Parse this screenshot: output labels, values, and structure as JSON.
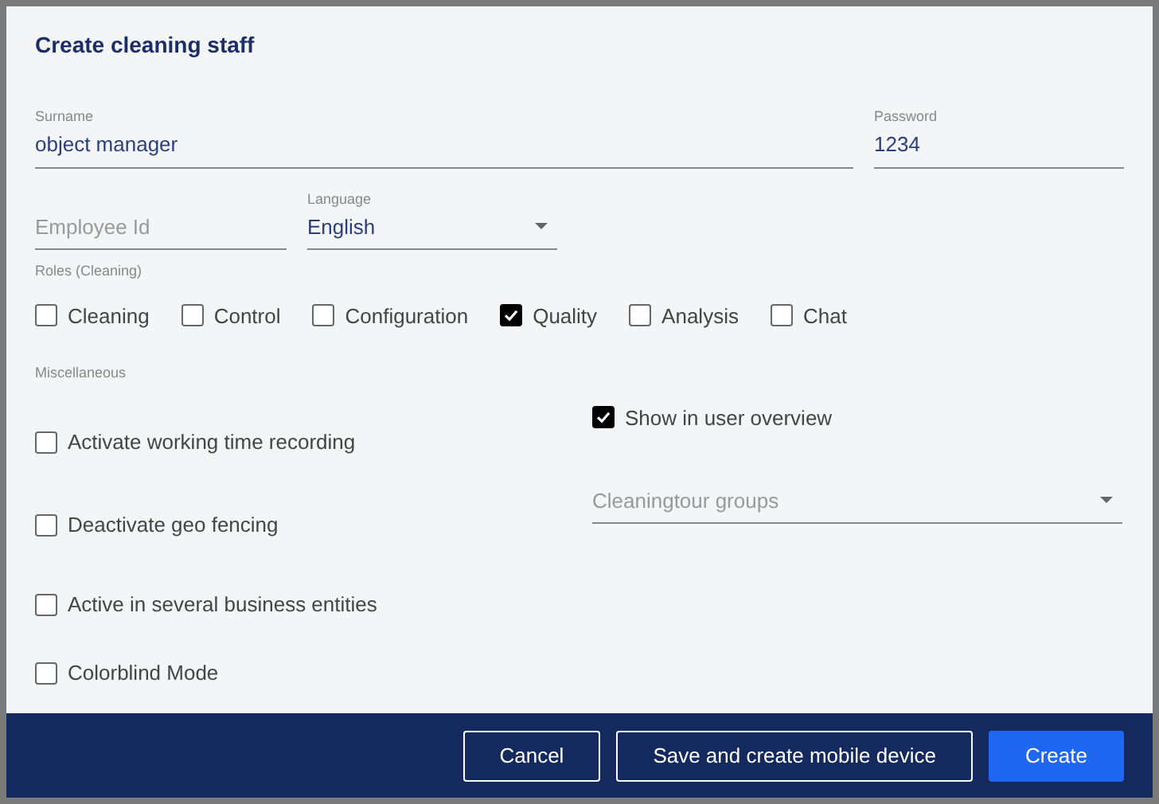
{
  "dialog": {
    "title": "Create cleaning staff"
  },
  "fields": {
    "surname": {
      "label": "Surname",
      "value": "object manager"
    },
    "password": {
      "label": "Password",
      "value": "1234"
    },
    "employee_id": {
      "placeholder": "Employee Id"
    },
    "language": {
      "label": "Language",
      "value": "English"
    }
  },
  "roles": {
    "label": "Roles (Cleaning)",
    "items": [
      {
        "label": "Cleaning",
        "checked": false
      },
      {
        "label": "Control",
        "checked": false
      },
      {
        "label": "Configuration",
        "checked": false
      },
      {
        "label": "Quality",
        "checked": true
      },
      {
        "label": "Analysis",
        "checked": false
      },
      {
        "label": "Chat",
        "checked": false
      }
    ]
  },
  "miscellaneous": {
    "label": "Miscellaneous",
    "left": [
      {
        "label": "Activate working time recording",
        "checked": false
      },
      {
        "label": "Deactivate geo fencing",
        "checked": false
      },
      {
        "label": "Active in several business entities",
        "checked": false
      },
      {
        "label": "Colorblind Mode",
        "checked": false
      }
    ],
    "show_in_user_overview": {
      "label": "Show in user overview",
      "checked": true
    },
    "cleaningtour_groups": {
      "placeholder": "Cleaningtour groups"
    }
  },
  "buttons": [
    {
      "label": "Cancel",
      "kind": "outline"
    },
    {
      "label": "Save and create mobile device",
      "kind": "outline"
    },
    {
      "label": "Create",
      "kind": "primary"
    }
  ]
}
